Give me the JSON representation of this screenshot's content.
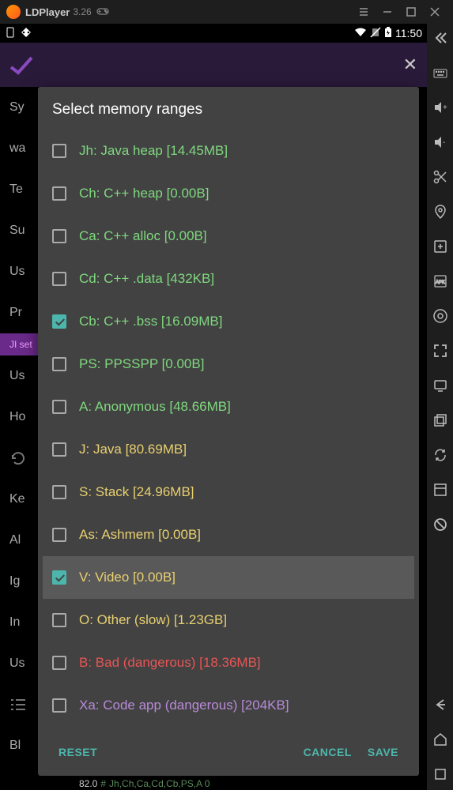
{
  "titlebar": {
    "name": "LDPlayer",
    "version": "3.26"
  },
  "statusbar": {
    "time": "11:50"
  },
  "dialog": {
    "title": "Select memory ranges",
    "items": [
      {
        "label": "Jh: Java heap [14.45MB]",
        "color": "green",
        "checked": false,
        "selected": false
      },
      {
        "label": "Ch: C++ heap [0.00B]",
        "color": "green",
        "checked": false,
        "selected": false
      },
      {
        "label": "Ca: C++ alloc [0.00B]",
        "color": "green",
        "checked": false,
        "selected": false
      },
      {
        "label": "Cd: C++ .data [432KB]",
        "color": "green",
        "checked": false,
        "selected": false
      },
      {
        "label": "Cb: C++ .bss [16.09MB]",
        "color": "green",
        "checked": true,
        "selected": false
      },
      {
        "label": "PS: PPSSPP [0.00B]",
        "color": "green",
        "checked": false,
        "selected": false
      },
      {
        "label": "A: Anonymous [48.66MB]",
        "color": "green",
        "checked": false,
        "selected": false
      },
      {
        "label": "J: Java [80.69MB]",
        "color": "yellow",
        "checked": false,
        "selected": false
      },
      {
        "label": "S: Stack [24.96MB]",
        "color": "yellow",
        "checked": false,
        "selected": false
      },
      {
        "label": "As: Ashmem [0.00B]",
        "color": "yellow",
        "checked": false,
        "selected": false
      },
      {
        "label": "V: Video [0.00B]",
        "color": "yellow",
        "checked": true,
        "selected": true
      },
      {
        "label": "O: Other (slow) [1.23GB]",
        "color": "yellow",
        "checked": false,
        "selected": false
      },
      {
        "label": "B: Bad (dangerous) [18.36MB]",
        "color": "red",
        "checked": false,
        "selected": false
      },
      {
        "label": "Xa: Code app (dangerous) [204KB]",
        "color": "purple",
        "checked": false,
        "selected": false
      }
    ],
    "buttons": {
      "reset": "RESET",
      "cancel": "CANCEL",
      "save": "SAVE"
    }
  },
  "bg": {
    "r1": "Sy",
    "r2": "wa",
    "r3": "Te",
    "r4": "Su",
    "r5": "Us",
    "r6": "Pr",
    "hl": "JI set",
    "r7": "Us",
    "r8": "Ho",
    "r9": "Ke",
    "r10": "Al",
    "r11": "Ig",
    "r12": "In",
    "r13": "Us",
    "r14": "Bl"
  },
  "bottom": {
    "value": "82.0",
    "hash": "#",
    "text": "Jh,Ch,Ca,Cd,Cb,PS,A 0"
  }
}
